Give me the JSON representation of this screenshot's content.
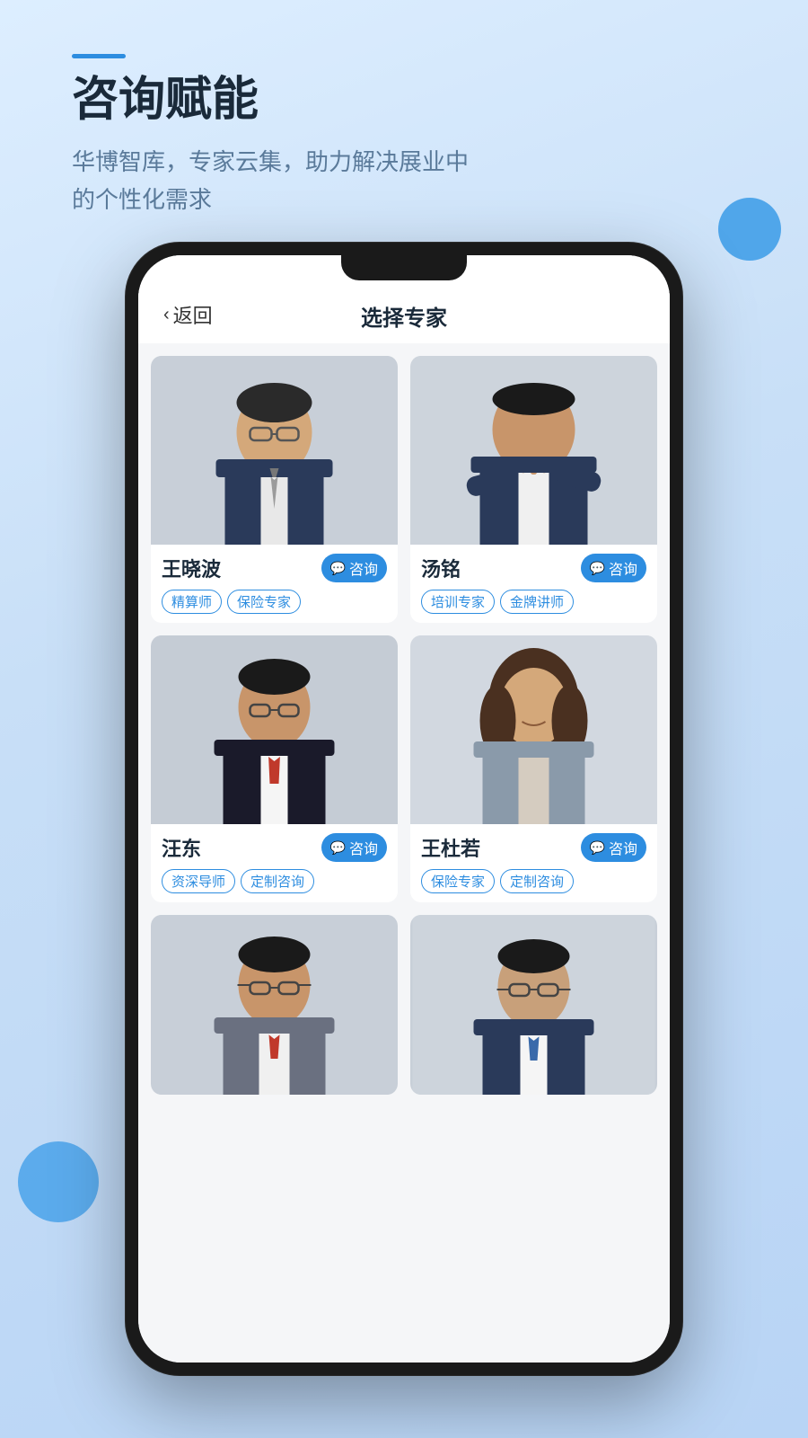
{
  "page": {
    "background": "#c8dff7",
    "accent_line_color": "#2d8de0"
  },
  "header": {
    "accent_line": true,
    "title": "咨询赋能",
    "subtitle": "华博智库，专家云集，助力解决展业中\n的个性化需求"
  },
  "phone": {
    "top_bar": {
      "back_label": "返回",
      "title": "选择专家"
    },
    "experts": [
      {
        "id": "wang-xiaobo",
        "name": "王晓波",
        "consult_label": "咨询",
        "tags": [
          "精算师",
          "保险专家"
        ],
        "photo_bg": "#c8cfd8"
      },
      {
        "id": "tang-ming",
        "name": "汤铭",
        "consult_label": "咨询",
        "tags": [
          "培训专家",
          "金牌讲师"
        ],
        "photo_bg": "#cdd4dc"
      },
      {
        "id": "wang-dong",
        "name": "汪东",
        "consult_label": "咨询",
        "tags": [
          "资深导师",
          "定制咨询"
        ],
        "photo_bg": "#c5ccd5"
      },
      {
        "id": "wang-duruo",
        "name": "王杜若",
        "consult_label": "咨询",
        "tags": [
          "保险专家",
          "定制咨询"
        ],
        "photo_bg": "#d2d8e0"
      }
    ],
    "partial_experts": [
      {
        "id": "expert-5",
        "photo_bg": "#c8cfd8"
      },
      {
        "id": "expert-6",
        "photo_bg": "#cdd4dc"
      }
    ]
  }
}
